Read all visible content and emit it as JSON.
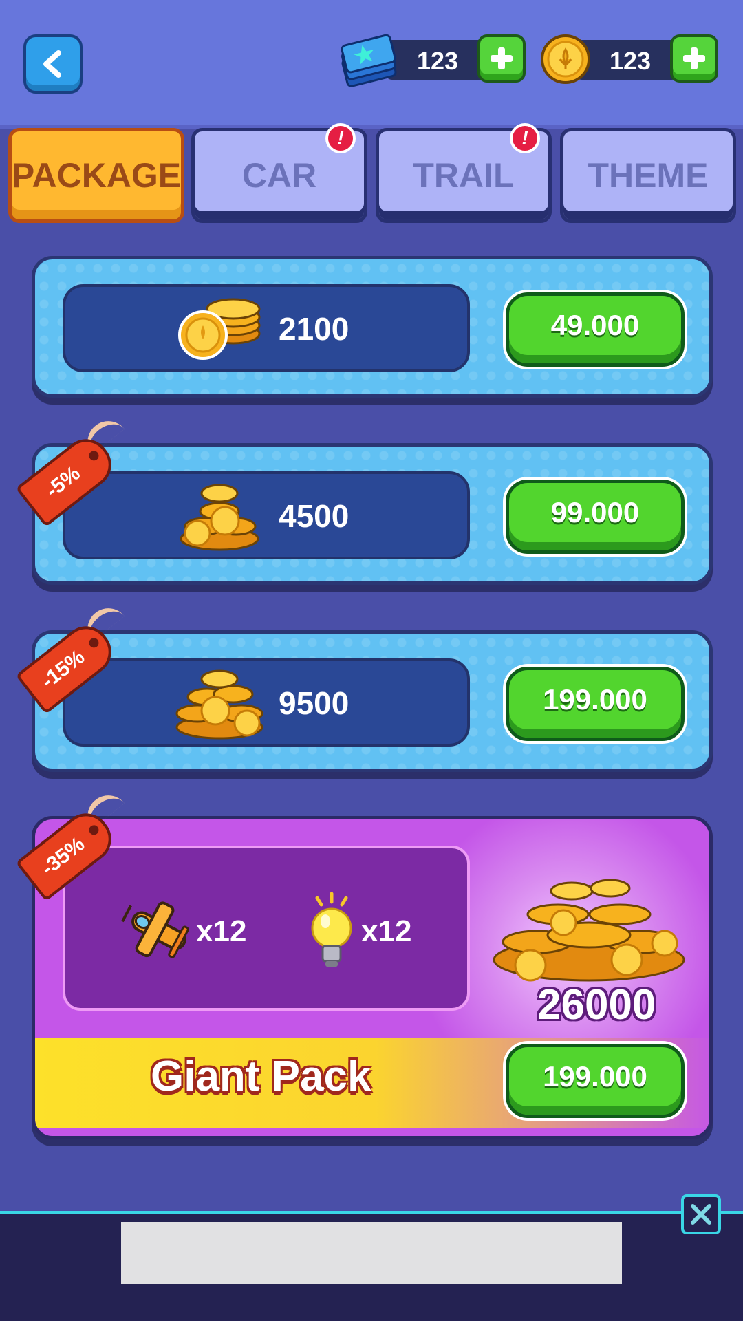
{
  "header": {
    "back_icon": "chevron-left-icon",
    "tickets": {
      "value": "123",
      "icon": "ticket-icon",
      "add_icon": "plus-icon"
    },
    "coins": {
      "value": "123",
      "icon": "coin-icon",
      "add_icon": "plus-icon"
    }
  },
  "tabs": [
    {
      "label": "PACKAGE",
      "active": true,
      "alert": false
    },
    {
      "label": "CAR",
      "active": false,
      "alert": true
    },
    {
      "label": "TRAIL",
      "active": false,
      "alert": true
    },
    {
      "label": "THEME",
      "active": false,
      "alert": false
    }
  ],
  "badge_text": "!",
  "packages": [
    {
      "amount": "2100",
      "price": "49.000",
      "discount": "",
      "icon": "coin-stack-icon"
    },
    {
      "amount": "4500",
      "price": "99.000",
      "discount": "-5%",
      "icon": "coin-pile-icon"
    },
    {
      "amount": "9500",
      "price": "199.000",
      "discount": "-15%",
      "icon": "coin-pile-icon"
    }
  ],
  "giant_pack": {
    "discount": "-35%",
    "name": "Giant Pack",
    "coins": "26000",
    "price": "199.000",
    "items": [
      {
        "icon": "airplane-icon",
        "count": "x12"
      },
      {
        "icon": "lightbulb-icon",
        "count": "x12"
      }
    ]
  },
  "ad": {
    "close_icon": "close-icon"
  },
  "colors": {
    "active_tab": "#ffb830",
    "inactive_tab": "#aeb3f7",
    "buy_button": "#52d52e",
    "card": "#61c1f3",
    "giant_card": "#c456e8",
    "discount_tag": "#e8401e"
  }
}
